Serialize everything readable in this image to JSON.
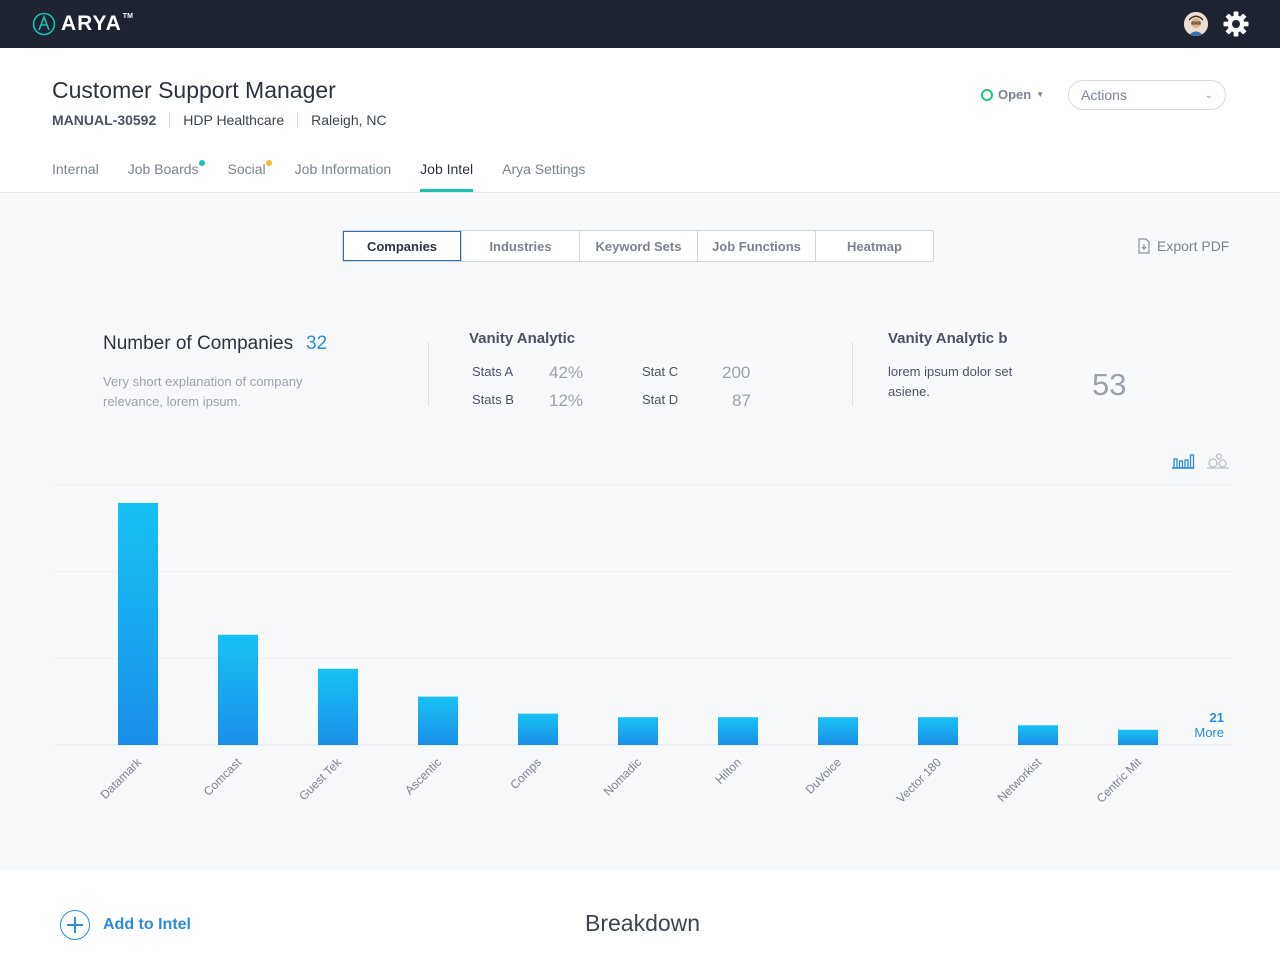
{
  "app": {
    "name": "ARYA",
    "trademark": "TM"
  },
  "topbar": {
    "avatar_icon": "user-avatar",
    "settings_icon": "gear-icon"
  },
  "job": {
    "title": "Customer Support Manager",
    "id": "MANUAL-30592",
    "company": "HDP Healthcare",
    "location": "Raleigh, NC",
    "status": "Open",
    "status_color": "#21c87a",
    "actions_label": "Actions"
  },
  "tabs": [
    {
      "label": "Internal",
      "active": false,
      "dot": null
    },
    {
      "label": "Job Boards",
      "active": false,
      "dot": "#17c3b2"
    },
    {
      "label": "Social",
      "active": false,
      "dot": "#f5b82e"
    },
    {
      "label": "Job Information",
      "active": false,
      "dot": null
    },
    {
      "label": "Job Intel",
      "active": true,
      "dot": null
    },
    {
      "label": "Arya Settings",
      "active": false,
      "dot": null
    }
  ],
  "segments": [
    {
      "label": "Companies",
      "active": true
    },
    {
      "label": "Industries",
      "active": false
    },
    {
      "label": "Keyword Sets",
      "active": false
    },
    {
      "label": "Job Functions",
      "active": false
    },
    {
      "label": "Heatmap",
      "active": false
    }
  ],
  "export_label": "Export PDF",
  "summary": {
    "companies_title": "Number of Companies",
    "companies_count": "32",
    "companies_desc": "Very short explanation of company relevance, lorem ipsum.",
    "vanity_title": "Vanity Analytic",
    "stats": [
      {
        "label": "Stats A",
        "value": "42%"
      },
      {
        "label": "Stats B",
        "value": "12%"
      },
      {
        "label": "Stat C",
        "value": "200"
      },
      {
        "label": "Stat D",
        "value": "87"
      }
    ],
    "vanity_b_title": "Vanity Analytic b",
    "vanity_b_desc": "lorem ipsum dolor set asiene.",
    "vanity_b_value": "53"
  },
  "view_toggle": {
    "bar_icon": "bar-chart-icon",
    "bubble_icon": "bubble-chart-icon",
    "active": "bar"
  },
  "chart_data": {
    "type": "bar",
    "title": "",
    "xlabel": "",
    "ylabel": "",
    "categories": [
      "Datamark",
      "Comcast",
      "Guest Tek",
      "Ascentic",
      "Comps",
      "Nomadic",
      "Hilton",
      "DuVoice",
      "Vector 180",
      "Networkist",
      "Centric Mit"
    ],
    "values": [
      27,
      12.3,
      8.5,
      5.4,
      3.5,
      3.1,
      3.1,
      3.1,
      3.1,
      2.2,
      1.7
    ],
    "ylim": [
      0,
      29
    ],
    "grid": true,
    "legend": "none",
    "bar_color_top": "#17c1f5",
    "bar_color_bottom": "#1a8fe8",
    "more_count": "21",
    "more_label": "More"
  },
  "bottom": {
    "add_label": "Add to Intel",
    "breakdown_title": "Breakdown"
  }
}
